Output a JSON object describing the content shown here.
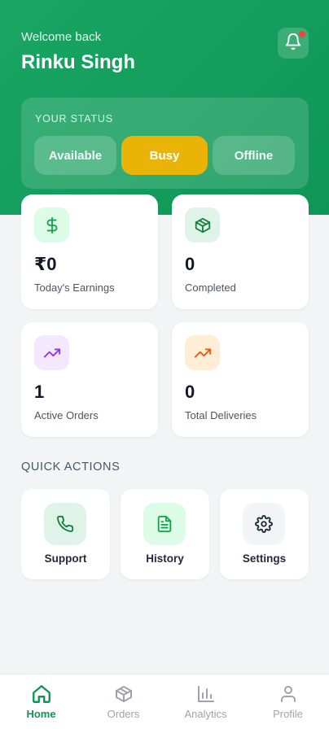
{
  "header": {
    "welcome": "Welcome back",
    "name": "Rinku Singh"
  },
  "status": {
    "title": "YOUR STATUS",
    "options": [
      "Available",
      "Busy",
      "Offline"
    ],
    "selected": "Busy"
  },
  "stats": [
    {
      "value": "₹0",
      "label": "Today's Earnings",
      "icon": "dollar-icon",
      "color": "#16a34a",
      "bg": "#dcfce7"
    },
    {
      "value": "0",
      "label": "Completed",
      "icon": "package-icon",
      "color": "#15803d",
      "bg": "#dff3e8"
    },
    {
      "value": "1",
      "label": "Active Orders",
      "icon": "trending-up-icon",
      "color": "#9333ea",
      "bg": "#f3e8ff"
    },
    {
      "value": "0",
      "label": "Total Deliveries",
      "icon": "trending-up-icon",
      "color": "#ea580c",
      "bg": "#ffedd5"
    }
  ],
  "quick_actions": {
    "title": "QUICK ACTIONS",
    "items": [
      {
        "label": "Support",
        "icon": "phone-icon"
      },
      {
        "label": "History",
        "icon": "document-icon"
      },
      {
        "label": "Settings",
        "icon": "gear-icon"
      }
    ]
  },
  "nav": {
    "items": [
      {
        "label": "Home",
        "icon": "home-icon"
      },
      {
        "label": "Orders",
        "icon": "package-icon"
      },
      {
        "label": "Analytics",
        "icon": "bar-chart-icon"
      },
      {
        "label": "Profile",
        "icon": "user-icon"
      }
    ],
    "active": "Home"
  },
  "colors": {
    "brand": "#0f9656",
    "busy": "#eab308",
    "notification_dot": "#ef4444"
  }
}
